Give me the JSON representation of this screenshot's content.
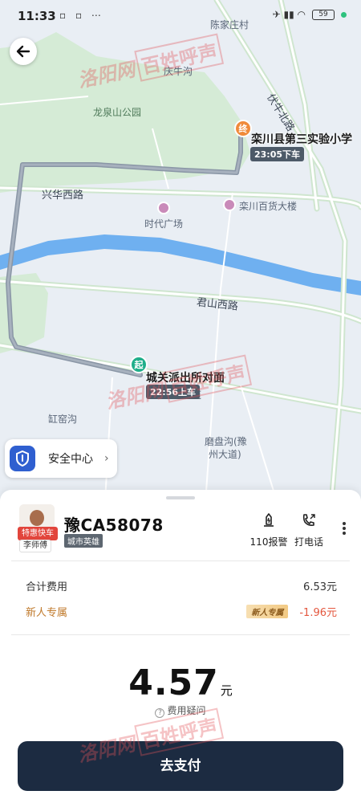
{
  "status_bar": {
    "time": "11:33",
    "left_icons": "▫ ▫ ⋯",
    "right_icons": "✈ ▮▮ ◠",
    "battery": "59"
  },
  "map": {
    "labels": {
      "chenjiazhuang": "陈家庄村",
      "longquanshan_park": "龙泉山公园",
      "qinggou": "庆牛沟",
      "times_square": "时代广场",
      "luanchuan_dept": "栾川百货大楼",
      "hongyaogou": "缸窑沟",
      "mopangou": "磨盘沟(豫",
      "mopangou2": "州大道)"
    },
    "roads": {
      "xinghua_west": "兴华西路",
      "junshan_west": "君山西路",
      "funiu_north": "伏牛北路",
      "street_suffix": "道"
    },
    "destination": {
      "badge": "终",
      "name": "栾川县第三实验小学",
      "time": "23:05下车"
    },
    "origin": {
      "badge": "起",
      "name": "城关派出所对面",
      "time": "22:56上车"
    }
  },
  "safety_center": {
    "label": "安全中心",
    "arrow": "›"
  },
  "driver": {
    "tag": "特惠快车",
    "name": "李师傅",
    "plate": "豫CA58078",
    "car_model": "城市英雄"
  },
  "actions": {
    "alarm_label": "110报警",
    "alarm_glyph": "⚠",
    "call_label": "打电话",
    "call_glyph": "☏"
  },
  "fees": {
    "total_label": "合计费用",
    "total_value": "6.53元",
    "promo_label": "新人专属",
    "promo_badge": "新人专属",
    "promo_value": "-1.96元"
  },
  "payable": {
    "amount": "4.57",
    "unit": "元",
    "question": "费用疑问",
    "question_glyph": "?"
  },
  "pay_button": "去支付",
  "watermark": {
    "brand": "洛阳网",
    "stamp": "百姓呼声"
  },
  "colors": {
    "pay_button": "#1c2b41",
    "origin_pin": "#1fae8a",
    "destination_pin": "#f08a3a",
    "river": "#6fb0f0",
    "park": "#d7ecd9",
    "route": "#8a96a6"
  }
}
